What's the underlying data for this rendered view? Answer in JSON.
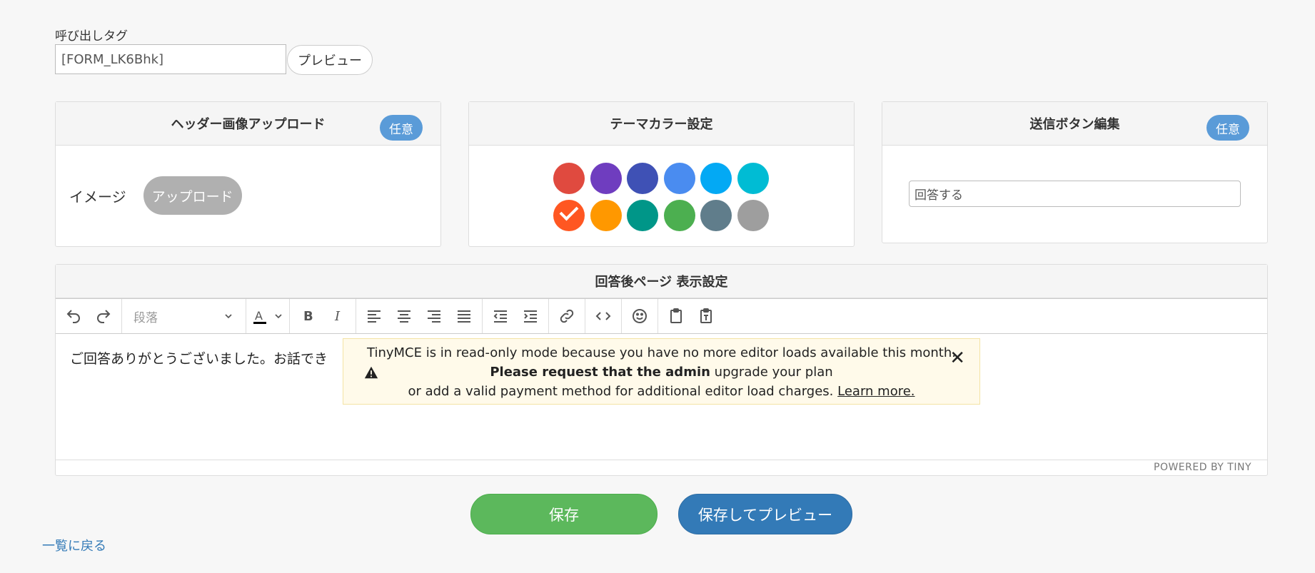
{
  "tag": {
    "label": "呼び出しタグ",
    "value": "[FORM_LK6Bhk]",
    "preview_label": "プレビュー"
  },
  "header_image": {
    "title": "ヘッダー画像アップロード",
    "badge": "任意",
    "image_label": "イメージ",
    "upload_label": "アップロード"
  },
  "theme": {
    "title": "テーマカラー設定",
    "colors": [
      "#e04a3f",
      "#6f3dbf",
      "#3f51b5",
      "#4a8cf0",
      "#03a9f4",
      "#00bcd4",
      "#ff5722",
      "#ff9800",
      "#009688",
      "#4caf50",
      "#607d8b",
      "#9e9e9e"
    ],
    "selected_index": 6
  },
  "submit_button": {
    "title": "送信ボタン編集",
    "badge": "任意",
    "value": "回答する"
  },
  "after_page": {
    "title": "回答後ページ 表示設定",
    "format_label": "段落",
    "content": "ご回答ありがとうございました。お話でき",
    "notice": {
      "line1": "TinyMCE is in read-only mode because you have no more editor loads available this month.",
      "bold": "Please request that the admin",
      "line2_rest": " upgrade your plan",
      "line3": "or add a valid payment method for additional editor load charges.",
      "learn_more": "Learn more."
    },
    "powered_by": "POWERED BY TINY"
  },
  "actions": {
    "save": "保存",
    "save_preview": "保存してプレビュー"
  },
  "back_link": "一覧に戻る"
}
